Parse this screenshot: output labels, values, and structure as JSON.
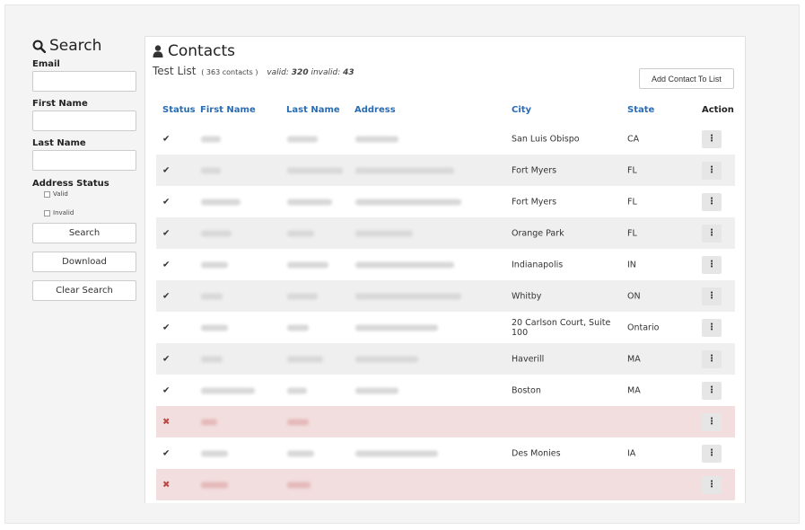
{
  "search": {
    "title": "Search",
    "email_label": "Email",
    "first_name_label": "First Name",
    "last_name_label": "Last Name",
    "address_status_label": "Address Status",
    "valid_label": "Valid",
    "invalid_label": "Invalid",
    "search_button": "Search",
    "download_button": "Download",
    "clear_button": "Clear Search"
  },
  "contacts": {
    "title": "Contacts",
    "list_name": "Test List",
    "count_text": "( 363 contacts )",
    "valid_label": "valid:",
    "valid_count": "320",
    "invalid_label": "invalid:",
    "invalid_count": "43",
    "add_button": "Add Contact To List",
    "columns": {
      "status": "Status",
      "first_name": "First Name",
      "last_name": "Last Name",
      "address": "Address",
      "city": "City",
      "state": "State",
      "action": "Action"
    },
    "rows": [
      {
        "status": "✔",
        "valid": true,
        "city": "San Luis Obispo",
        "state": "CA"
      },
      {
        "status": "✔",
        "valid": true,
        "city": "Fort Myers",
        "state": "FL"
      },
      {
        "status": "✔",
        "valid": true,
        "city": "Fort Myers",
        "state": "FL"
      },
      {
        "status": "✔",
        "valid": true,
        "city": "Orange Park",
        "state": "FL"
      },
      {
        "status": "✔",
        "valid": true,
        "city": "Indianapolis",
        "state": "IN"
      },
      {
        "status": "✔",
        "valid": true,
        "city": "Whitby",
        "state": "ON"
      },
      {
        "status": "✔",
        "valid": true,
        "city": "20 Carlson Court, Suite 100",
        "state": "Ontario"
      },
      {
        "status": "✔",
        "valid": true,
        "city": "Haverill",
        "state": "MA"
      },
      {
        "status": "✔",
        "valid": true,
        "city": "Boston",
        "state": "MA"
      },
      {
        "status": "✖",
        "valid": false,
        "city": "",
        "state": ""
      },
      {
        "status": "✔",
        "valid": true,
        "city": "Des Monies",
        "state": "IA"
      },
      {
        "status": "✖",
        "valid": false,
        "city": "",
        "state": ""
      }
    ],
    "action_glyph": "⋮"
  },
  "icons": {
    "search": "search-icon",
    "user": "user-icon",
    "check": "check-icon",
    "cross": "cross-icon",
    "kebab": "kebab-menu-icon"
  },
  "colors": {
    "link_blue": "#2a6cb3",
    "invalid_row": "#f2dede",
    "invalid_mark": "#b94a48",
    "alt_row": "#efefef"
  }
}
